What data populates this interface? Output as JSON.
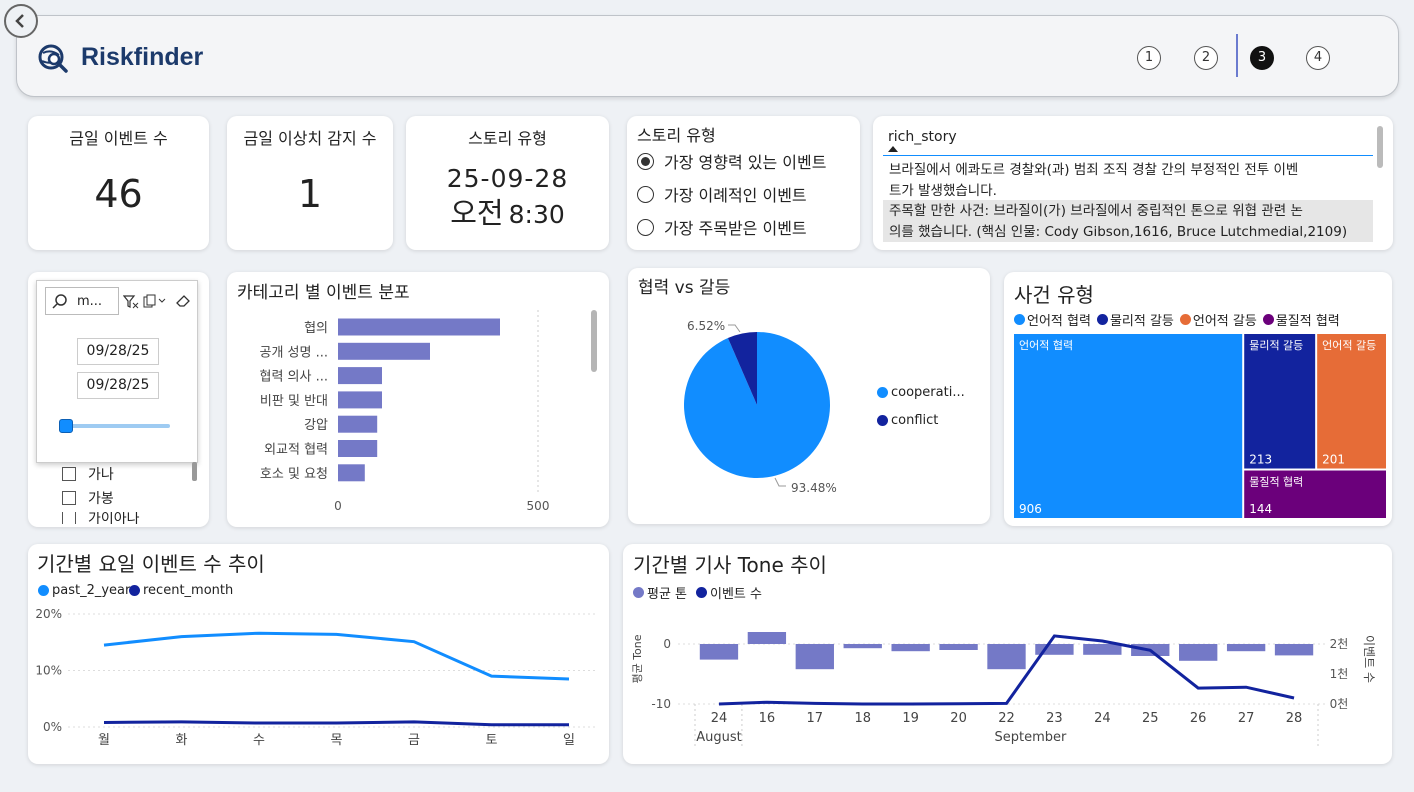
{
  "header": {
    "brand": "Riskfinder",
    "pages": [
      "1",
      "2",
      "3",
      "4"
    ],
    "active_page": 3
  },
  "kpis": {
    "events_today": {
      "label": "금일 이벤트 수",
      "value": "46"
    },
    "anomalies_today": {
      "label": "금일 이상치 감지 수",
      "value": "1"
    },
    "story_time": {
      "label": "스토리 유형",
      "date": "25-09-28",
      "ampm": "오전",
      "time": "8:30"
    }
  },
  "story_type": {
    "title": "스토리 유형",
    "options": [
      "가장 영향력 있는 이벤트",
      "가장 이례적인 이벤트",
      "가장 주목받은 이벤트"
    ],
    "selected": 0
  },
  "rich_story": {
    "header": "rich_story",
    "line1": "브라질에서 에콰도르 경찰와(과) 범죄 조직 경찰 간의 부정적인 전투 이벤",
    "line2": "트가 발생했습니다.",
    "line3": "주목할 만한 사건: 브라질이(가) 브라질에서 중립적인 톤으로 위협 관련 논",
    "line4": "의를 했습니다. (핵심 인물: Cody Gibson,1616, Bruce Lutchmedial,2109)"
  },
  "filter": {
    "search_value": "m...",
    "date_from": "09/28/25",
    "date_to": "09/28/25",
    "list_items": [
      "가나",
      "가봉",
      "가이아나"
    ]
  },
  "category_chart": {
    "title": "카테고리 별 이벤트 분포",
    "chart_data": {
      "type": "bar",
      "orientation": "horizontal",
      "categories": [
        "협의",
        "공개 성명 ...",
        "협력 의사 ...",
        "비판 및 반대",
        "강압",
        "외교적 협력",
        "호소 및 요청"
      ],
      "values": [
        405,
        230,
        110,
        110,
        98,
        98,
        67
      ],
      "xlim": [
        0,
        580
      ],
      "xticks": [
        "0",
        "500"
      ],
      "color": "#7479c7"
    }
  },
  "coop_conflict": {
    "title": "협력 vs 갈등",
    "chart_data": {
      "type": "pie",
      "labels": [
        "cooperati...",
        "conflict"
      ],
      "values": [
        93.48,
        6.52
      ],
      "data_labels": [
        "93.48%",
        "6.52%"
      ],
      "colors": [
        "#118dff",
        "#12239e"
      ]
    }
  },
  "incident_type": {
    "title": "사건 유형",
    "chart_data": {
      "type": "treemap",
      "labels": [
        "언어적 협력",
        "물리적 갈등",
        "언어적 갈등",
        "물질적 협력"
      ],
      "values": [
        906,
        213,
        201,
        144
      ],
      "colors": [
        "#118dff",
        "#12239e",
        "#e66c37",
        "#6b007b"
      ]
    }
  },
  "weekday_trend": {
    "title": "기간별 요일 이벤트 수 추이",
    "chart_data": {
      "type": "line",
      "categories": [
        "월",
        "화",
        "수",
        "목",
        "금",
        "토",
        "일"
      ],
      "series": [
        {
          "name": "past_2_years",
          "color": "#118dff",
          "values": [
            14.5,
            16.0,
            16.6,
            16.4,
            15.1,
            9.0,
            8.5
          ]
        },
        {
          "name": "recent_month",
          "color": "#12239e",
          "values": [
            0.8,
            0.9,
            0.7,
            0.7,
            0.9,
            0.4,
            0.4
          ]
        }
      ],
      "yticks": [
        "0%",
        "10%",
        "20%"
      ],
      "ylim": [
        0,
        20
      ]
    }
  },
  "tone_trend": {
    "title": "기간별 기사 Tone 추이",
    "chart_data": {
      "type": "bar+line",
      "categories": [
        "24",
        "16",
        "17",
        "18",
        "19",
        "20",
        "22",
        "23",
        "24",
        "25",
        "26",
        "27",
        "28"
      ],
      "month_labels": [
        "August",
        "September"
      ],
      "series": [
        {
          "name": "평균 톤",
          "color": "#7479c7",
          "axis": "left",
          "values": [
            -2.6,
            2.0,
            -4.2,
            -0.7,
            -1.2,
            -1.0,
            -4.2,
            -1.8,
            -1.8,
            -2.0,
            -2.8,
            -1.2,
            -1.9
          ]
        },
        {
          "name": "이벤트 수",
          "color": "#12239e",
          "axis": "right",
          "values": [
            0,
            60,
            20,
            0,
            0,
            10,
            20,
            2270,
            2100,
            1790,
            530,
            560,
            200
          ]
        }
      ],
      "ylabel_left": "평균 Tone",
      "ylabel_right": "이벤트 수",
      "yticks_left": [
        "0",
        "-10"
      ],
      "yticks_right": [
        "0천",
        "1천",
        "2천"
      ],
      "ylim_left": [
        -10,
        5
      ],
      "ylim_right": [
        0,
        3000
      ]
    }
  }
}
